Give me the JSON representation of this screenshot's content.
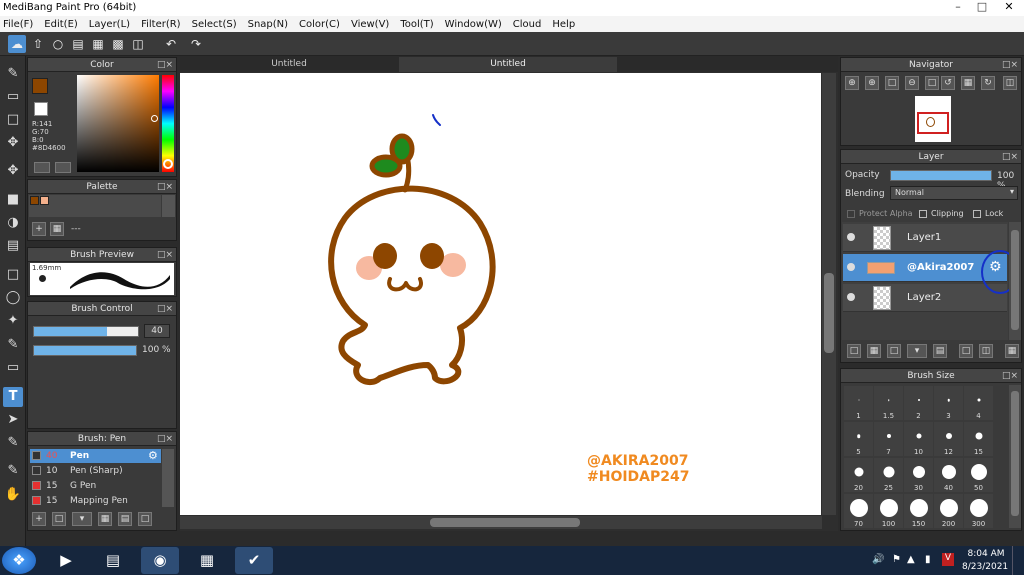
{
  "app": {
    "title": "MediBang Paint Pro (64bit)"
  },
  "menu": [
    "File(F)",
    "Edit(E)",
    "Layer(L)",
    "Filter(R)",
    "Select(S)",
    "Snap(N)",
    "Color(C)",
    "View(V)",
    "Tool(T)",
    "Window(W)",
    "Cloud",
    "Help"
  ],
  "tabs": [
    {
      "label": "Untitled"
    },
    {
      "label": "Untitled"
    }
  ],
  "color_panel": {
    "title": "Color",
    "r": "R:141",
    "g": "G:70",
    "b": "B:0",
    "hex": "#8D4600",
    "fg": "#8d4600",
    "bg": "#ffffff"
  },
  "palette_panel": {
    "title": "Palette",
    "swatches": [
      "#8d4600",
      "#f4b08c"
    ],
    "entry": "---"
  },
  "brush_preview": {
    "title": "Brush Preview",
    "size": "1.69mm"
  },
  "brush_control": {
    "title": "Brush Control",
    "size_value": "40",
    "size_fraction": 0.7,
    "opacity_value": "100 %",
    "opacity_fraction": 1.0
  },
  "brush_list": {
    "title": "Brush: Pen",
    "items": [
      {
        "size": "40",
        "name": "Pen",
        "color": "#333333",
        "selected": true
      },
      {
        "size": "10",
        "name": "Pen (Sharp)",
        "color": "#333333",
        "selected": false
      },
      {
        "size": "15",
        "name": "G Pen",
        "color": "#e53030",
        "selected": false
      },
      {
        "size": "15",
        "name": "Mapping Pen",
        "color": "#e53030",
        "selected": false
      }
    ]
  },
  "navigator": {
    "title": "Navigator"
  },
  "layer_panel": {
    "title": "Layer",
    "opacity_label": "Opacity",
    "opacity_value": "100 %",
    "opacity_fraction": 1.0,
    "blending_label": "Blending",
    "blending_value": "Normal",
    "protect_alpha": "Protect Alpha",
    "clipping": "Clipping",
    "lock": "Lock",
    "layers": [
      {
        "name": "Layer1",
        "selected": false
      },
      {
        "name": "@Akira2007",
        "selected": true
      },
      {
        "name": "Layer2",
        "selected": false
      }
    ]
  },
  "brush_size_panel": {
    "title": "Brush Size",
    "sizes": [
      "1",
      "1.5",
      "2",
      "3",
      "4",
      "5",
      "7",
      "10",
      "12",
      "15",
      "20",
      "25",
      "30",
      "40",
      "50",
      "70",
      "100",
      "150",
      "200",
      "300"
    ]
  },
  "canvas": {
    "watermark_line1": "@AKIRA2007",
    "watermark_line2": "#HOIDAP247",
    "stroke_color": "#8d4600",
    "leaf_color": "#1e8a1e",
    "blush_color": "#f7b9a0"
  },
  "taskbar": {
    "time": "8:04 AM",
    "date": "8/23/2021"
  }
}
